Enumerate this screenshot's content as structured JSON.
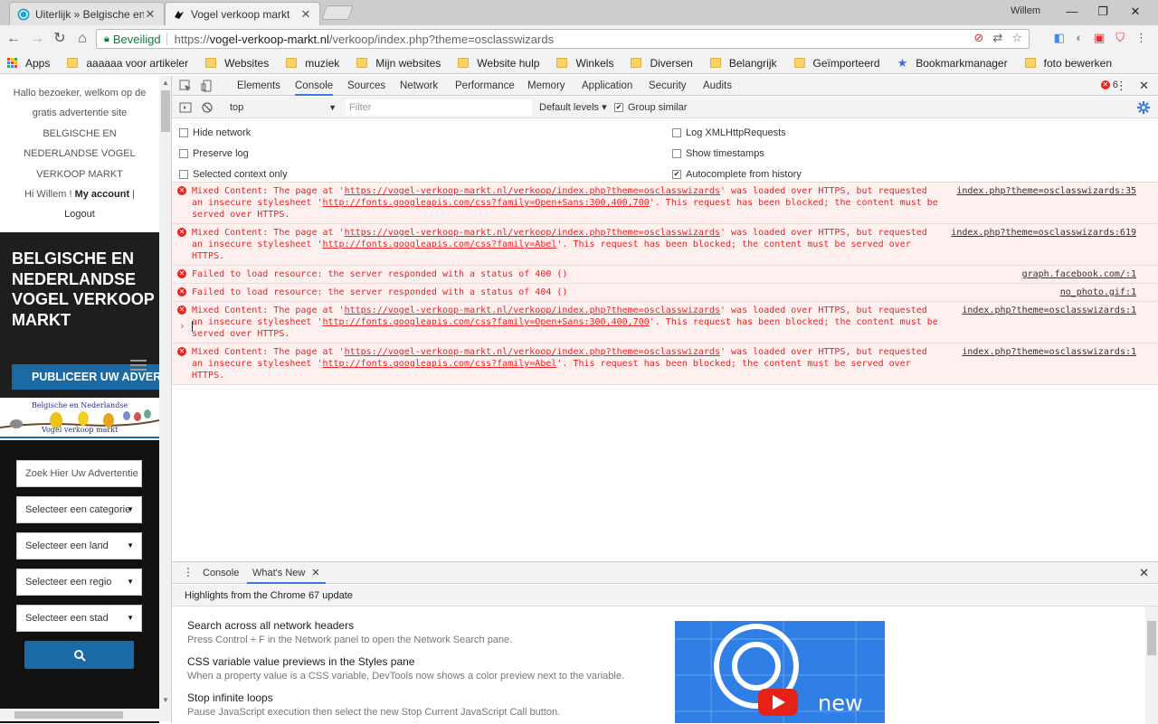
{
  "tabs": [
    {
      "title": "Uiterlijk » Belgische en N",
      "close": "✕"
    },
    {
      "title": "Vogel verkoop markt",
      "close": "✕"
    }
  ],
  "window": {
    "user": "Willem",
    "minimize": "—",
    "maximize": "❐",
    "close": "✕"
  },
  "omnibox": {
    "secure_label": "Beveiligd",
    "url_scheme": "https://",
    "url_host": "vogel-verkoop-markt.nl",
    "url_path": "/verkoop/index.php?theme=osclasswizards"
  },
  "bookmarks": [
    {
      "label": "Apps",
      "kind": "apps"
    },
    {
      "label": "aaaaaa voor artikeler",
      "kind": "folder"
    },
    {
      "label": "Websites",
      "kind": "folder"
    },
    {
      "label": "muziek",
      "kind": "folder"
    },
    {
      "label": "Mijn websites",
      "kind": "folder"
    },
    {
      "label": "Website hulp",
      "kind": "folder"
    },
    {
      "label": "Winkels",
      "kind": "folder"
    },
    {
      "label": "Diversen",
      "kind": "folder"
    },
    {
      "label": "Belangrijk",
      "kind": "folder"
    },
    {
      "label": "Geïmporteerd",
      "kind": "folder"
    },
    {
      "label": "Bookmarkmanager",
      "kind": "star"
    },
    {
      "label": "foto bewerken",
      "kind": "folder"
    }
  ],
  "page": {
    "welcome_lines": [
      "Hallo bezoeker, welkom op de",
      "gratis advertentie site",
      "BELGISCHE EN",
      "NEDERLANDSE VOGEL",
      "VERKOOP MARKT"
    ],
    "greeting": "Hi Willem !",
    "my_account": "My account",
    "separator": "|",
    "logout": "Logout",
    "hero_title": "BELGISCHE EN NEDERLANDSE VOGEL VERKOOP MARKT",
    "publish_button": "PUBLICEER UW ADVERTENTIE",
    "logo_line1": "Belgische en Nederlandse",
    "logo_line2": "Vogel verkoop markt",
    "search_placeholder": "Zoek Hier Uw Advertentie",
    "selects": [
      "Selecteer een categorie",
      "Selecteer een land",
      "Selecteer een regio",
      "Selecteer een stad"
    ]
  },
  "devtools": {
    "tabs": [
      "Elements",
      "Console",
      "Sources",
      "Network",
      "Performance",
      "Memory",
      "Application",
      "Security",
      "Audits"
    ],
    "active_tab": "Console",
    "error_count": "6",
    "context": "top",
    "filter_placeholder": "Filter",
    "levels": "Default levels ▾",
    "group_similar": "Group similar",
    "settings_left": [
      {
        "label": "Hide network",
        "checked": false
      },
      {
        "label": "Preserve log",
        "checked": false
      },
      {
        "label": "Selected context only",
        "checked": false
      }
    ],
    "settings_right": [
      {
        "label": "Log XMLHttpRequests",
        "checked": false
      },
      {
        "label": "Show timestamps",
        "checked": false
      },
      {
        "label": "Autocomplete from history",
        "checked": true
      }
    ],
    "messages": [
      {
        "pre": "Mixed Content: The page at '",
        "link1": "https://vogel-verkoop-markt.nl/verkoop/index.php?theme=osclasswizards",
        "mid": "' was loaded over HTTPS, but requested an insecure stylesheet '",
        "link2": "http://fonts.googleapis.com/css?family=Open+Sans:300,400,700",
        "post": "'. This request has been blocked; the content must be served over HTTPS.",
        "source": "index.php?theme=osclasswizards:35"
      },
      {
        "pre": "Mixed Content: The page at '",
        "link1": "https://vogel-verkoop-markt.nl/verkoop/index.php?theme=osclasswizards",
        "mid": "' was loaded over HTTPS, but requested an insecure stylesheet '",
        "link2": "http://fonts.googleapis.com/css?family=Abel",
        "post": "'. This request has been blocked; the content must be served over HTTPS.",
        "source": "index.php?theme=osclasswizards:619"
      },
      {
        "pre": "Failed to load resource: the server responded with a status of 400 ()",
        "link1": "",
        "mid": "",
        "link2": "",
        "post": "",
        "source": "graph.facebook.com/:1"
      },
      {
        "pre": "Failed to load resource: the server responded with a status of 404 ()",
        "link1": "",
        "mid": "",
        "link2": "",
        "post": "",
        "source": "no_photo.gif:1"
      },
      {
        "pre": "Mixed Content: The page at '",
        "link1": "https://vogel-verkoop-markt.nl/verkoop/index.php?theme=osclasswizards",
        "mid": "' was loaded over HTTPS, but requested an insecure stylesheet '",
        "link2": "http://fonts.googleapis.com/css?family=Open+Sans:300,400,700",
        "post": "'. This request has been blocked; the content must be served over HTTPS.",
        "source": "index.php?theme=osclasswizards:1"
      },
      {
        "pre": "Mixed Content: The page at '",
        "link1": "https://vogel-verkoop-markt.nl/verkoop/index.php?theme=osclasswizards",
        "mid": "' was loaded over HTTPS, but requested an insecure stylesheet '",
        "link2": "http://fonts.googleapis.com/css?family=Abel",
        "post": "'. This request has been blocked; the content must be served over HTTPS.",
        "source": "index.php?theme=osclasswizards:1"
      }
    ],
    "prompt": "›",
    "drawer": {
      "tabs": [
        "Console",
        "What's New"
      ],
      "active_tab": "What's New",
      "tab_close": "✕",
      "close": "✕",
      "highlights": "Highlights from the Chrome 67 update",
      "features": [
        {
          "title": "Search across all network headers",
          "desc": "Press Control + F in the Network panel to open the Network Search pane."
        },
        {
          "title": "CSS variable value previews in the Styles pane",
          "desc": "When a property value is a CSS variable, DevTools now shows a color preview next to the variable."
        },
        {
          "title": "Stop infinite loops",
          "desc": "Pause JavaScript execution then select the new Stop Current JavaScript Call button."
        }
      ],
      "promo_text": "new"
    }
  },
  "colors": {
    "accent": "#3879d9",
    "error": "#e22222",
    "brand_blue": "#1a6aa6",
    "secure_green": "#0b8043"
  }
}
